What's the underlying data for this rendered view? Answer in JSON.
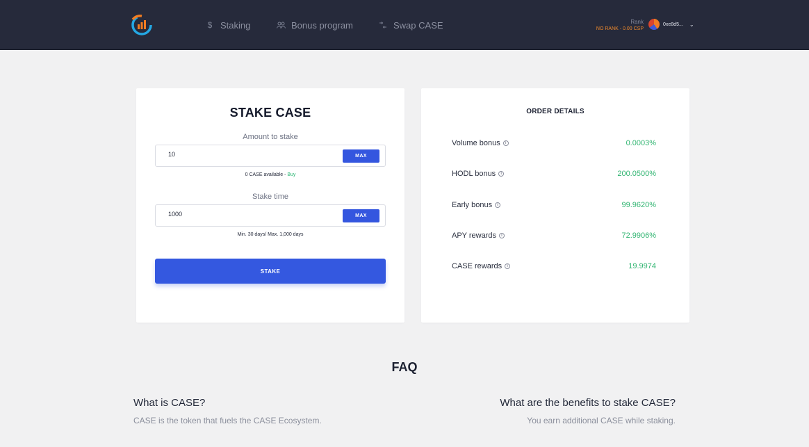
{
  "header": {
    "nav": [
      {
        "label": "Staking",
        "icon": "dollar-icon"
      },
      {
        "label": "Bonus program",
        "icon": "users-icon"
      },
      {
        "label": "Swap CASE",
        "icon": "swap-icon"
      }
    ],
    "rank_label": "Rank",
    "rank_value": "NO RANK - 0.00 CSP",
    "account_address": "0xe8d5..."
  },
  "stake": {
    "title": "STAKE CASE",
    "amount_label": "Amount to stake",
    "amount_value": "10",
    "max_label": "MAX",
    "available_text": "0 CASE available - ",
    "buy_label": "Buy",
    "time_label": "Stake time",
    "time_value": "1000",
    "time_hint": "Min. 30 days/ Max. 1,000 days",
    "stake_button": "STAKE"
  },
  "order": {
    "title": "ORDER DETAILS",
    "rows": [
      {
        "label": "Volume bonus",
        "value": "0.0003%"
      },
      {
        "label": "HODL bonus",
        "value": "200.0500%"
      },
      {
        "label": "Early bonus",
        "value": "99.9620%"
      },
      {
        "label": "APY rewards",
        "value": "72.9906%"
      },
      {
        "label": "CASE rewards",
        "value": "19.9974"
      }
    ]
  },
  "faq": {
    "title": "FAQ",
    "items": [
      {
        "q": "What is CASE?",
        "a": "CASE is the token that fuels the CASE Ecosystem."
      },
      {
        "q": "What are the benefits to stake CASE?",
        "a": "You earn additional CASE while staking."
      }
    ]
  },
  "colors": {
    "header_bg": "#262a3b",
    "primary_blue": "#3458e0",
    "positive_green": "#32b572",
    "rank_orange": "#f08a2c"
  }
}
